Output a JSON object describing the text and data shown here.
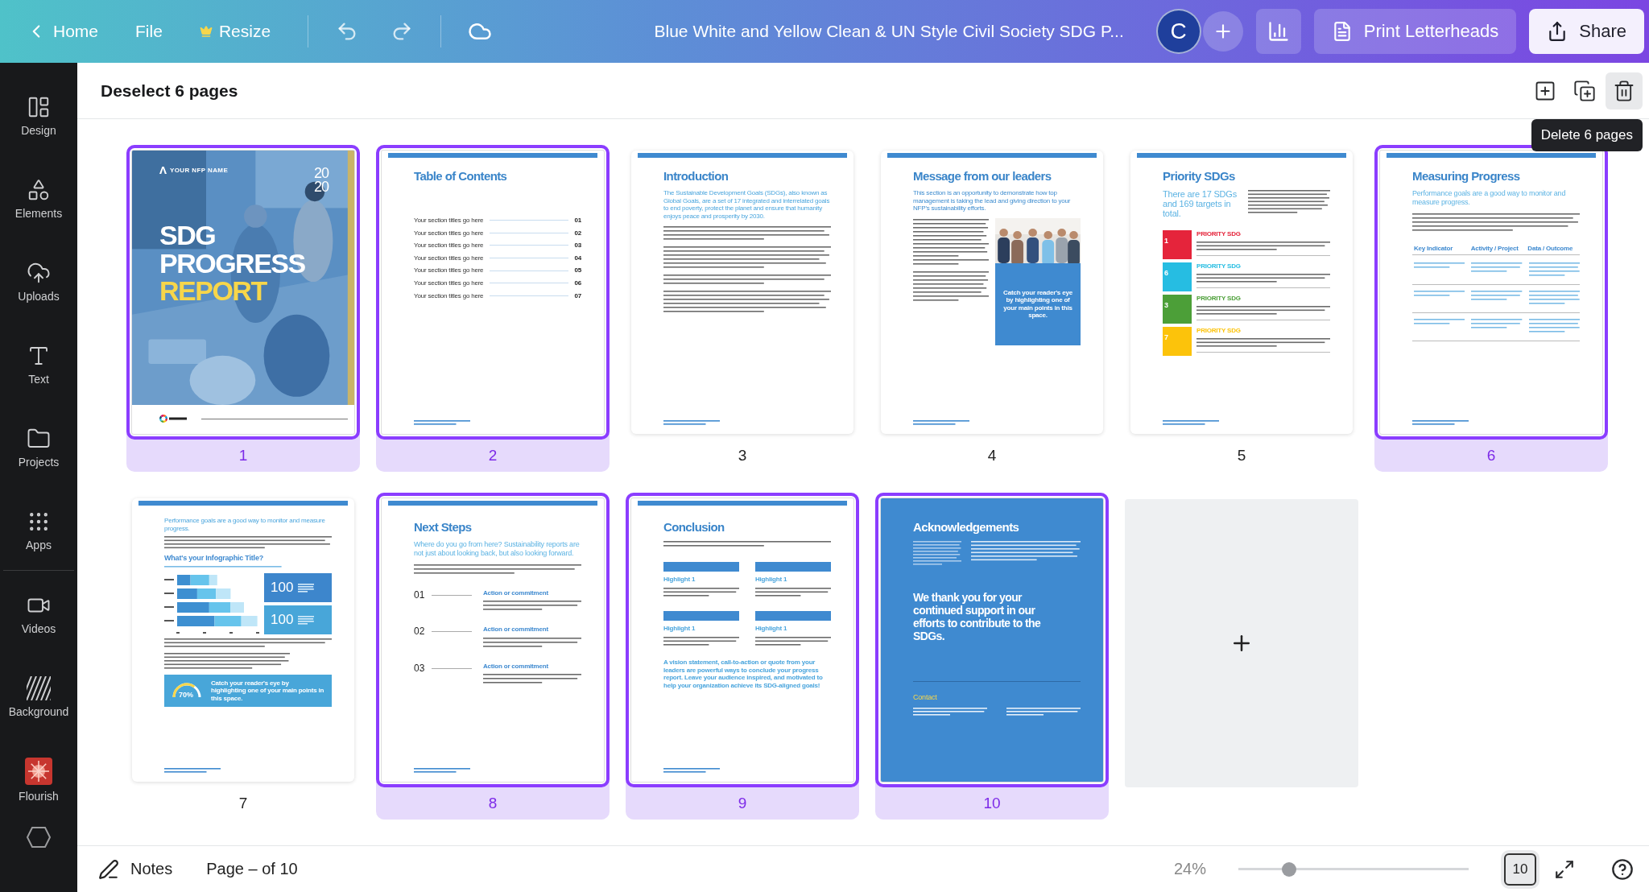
{
  "top_bar": {
    "nav": [
      {
        "label": "Home"
      },
      {
        "label": "File"
      },
      {
        "label": "Resize"
      }
    ],
    "title": "Blue White and Yellow Clean & UN Style Civil Society SDG P...",
    "avatar": "C",
    "buttons": [
      {
        "label": "Print Letterheads"
      },
      {
        "label": "Share"
      }
    ]
  },
  "sidebar": {
    "items": [
      {
        "label": "Design"
      },
      {
        "label": "Elements"
      },
      {
        "label": "Uploads"
      },
      {
        "label": "Text"
      },
      {
        "label": "Projects"
      },
      {
        "label": "Apps"
      },
      {
        "label": "Videos"
      },
      {
        "label": "Background"
      },
      {
        "label": "Flourish"
      }
    ]
  },
  "toolbar": {
    "selection": "Deselect 6 pages",
    "tooltip": "Delete 6 pages"
  },
  "pages": [
    {
      "number": "1",
      "selected": true,
      "kind": "cover",
      "org": "YOUR NFP NAME",
      "year": [
        "20",
        "20"
      ],
      "title": [
        "SDG",
        "PROGRESS"
      ],
      "highlight": "REPORT"
    },
    {
      "number": "2",
      "selected": true,
      "kind": "toc",
      "title": "Table of Contents",
      "rows": [
        {
          "label": "Your section titles go here",
          "number": "01"
        },
        {
          "label": "Your section titles go here",
          "number": "02"
        },
        {
          "label": "Your section titles go here",
          "number": "03"
        },
        {
          "label": "Your section titles go here",
          "number": "04"
        },
        {
          "label": "Your section titles go here",
          "number": "05"
        },
        {
          "label": "Your section titles go here",
          "number": "06"
        },
        {
          "label": "Your section titles go here",
          "number": "07"
        }
      ]
    },
    {
      "number": "3",
      "selected": false,
      "kind": "text",
      "title": "Introduction",
      "lead": "The Sustainable Development Goals (SDGs), also known as Global Goals, are a set of 17 integrated and interrelated goals to end poverty, protect the planet and ensure that humanity enjoys peace and prosperity by 2030."
    },
    {
      "number": "4",
      "selected": false,
      "kind": "leaders",
      "title": "Message from our leaders",
      "lead": "This section is an opportunity to demonstrate how top management is taking the lead and giving direction to your NFP's sustainability efforts.",
      "callout": "Catch your reader's eye by highlighting one of your main points in this space."
    },
    {
      "number": "5",
      "selected": false,
      "kind": "priority",
      "title": "Priority SDGs",
      "lead": "There are 17 SDGs and 169 targets in total.",
      "goals": [
        {
          "tile": "1",
          "color": "#e5243b",
          "label": "PRIORITY SDG"
        },
        {
          "tile": "6",
          "color": "#26bde2",
          "label": "PRIORITY SDG"
        },
        {
          "tile": "3",
          "color": "#4c9f38",
          "label": "PRIORITY SDG"
        },
        {
          "tile": "7",
          "color": "#fcc30b",
          "label": "PRIORITY SDG"
        }
      ]
    },
    {
      "number": "6",
      "selected": true,
      "kind": "measuring",
      "title": "Measuring Progress",
      "lead": "Performance goals are a good way to monitor and measure progress.",
      "columns": [
        "Key Indicator",
        "Activity / Project",
        "Data / Outcome"
      ]
    },
    {
      "number": "7",
      "selected": false,
      "kind": "infographic",
      "lead": "Performance goals are a good way to monitor and measure progress.",
      "heading": "What's your Infographic Title?",
      "stats": [
        {
          "value": "100",
          "color": "#3d86cc"
        },
        {
          "value": "100",
          "color": "#48a6d9"
        }
      ],
      "gauge": {
        "reading": "70%"
      },
      "callout": "Catch your reader's eye by highlighting one of your main points in this space."
    },
    {
      "number": "8",
      "selected": true,
      "kind": "steps",
      "title": "Next Steps",
      "lead": "Where do you go from here? Sustainability reports are not just about looking back, but also looking forward.",
      "steps": [
        {
          "number": "01",
          "label": "Action or commitment"
        },
        {
          "number": "02",
          "label": "Action or commitment"
        },
        {
          "number": "03",
          "label": "Action or commitment"
        }
      ]
    },
    {
      "number": "9",
      "selected": true,
      "kind": "conclusion",
      "title": "Conclusion",
      "highlights": [
        {
          "title": "Highlight 1"
        },
        {
          "title": "Highlight 1"
        },
        {
          "title": "Highlight 1"
        },
        {
          "title": "Highlight 1"
        }
      ],
      "quote": "A vision statement, call-to-action or quote from your leaders are powerful ways to conclude your progress report. Leave your audience inspired, and motivated to help your organization achieve its SDG-aligned goals!"
    },
    {
      "number": "10",
      "selected": true,
      "kind": "acknowledgements",
      "title": "Acknowledgements",
      "thanks": "We thank you for your continued support in our efforts to contribute to the SDGs.",
      "contact_title": "Contact"
    }
  ],
  "bottom_bar": {
    "notes": "Notes",
    "page_indicator": "Page – of 10",
    "zoom": "24%",
    "zoom_slider": {
      "level": 0.22
    },
    "page_count": "10"
  }
}
